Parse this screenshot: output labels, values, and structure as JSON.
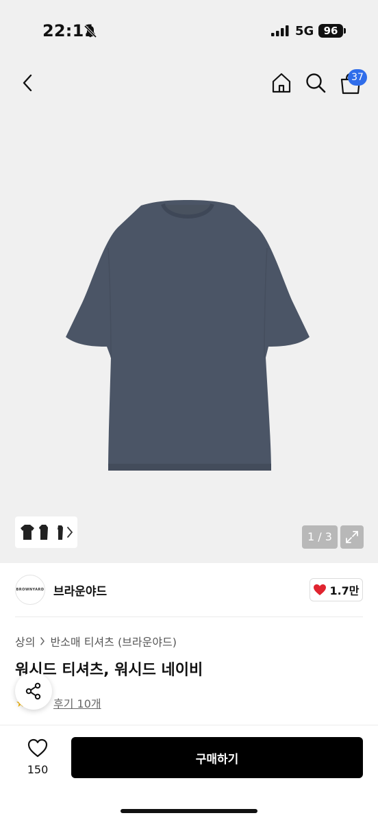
{
  "status_bar": {
    "time": "22:11",
    "network": "5G",
    "battery": "96"
  },
  "nav": {
    "cart_count": "37",
    "icons": [
      "chevron-left-icon",
      "home-icon",
      "search-icon",
      "shopping-bag-icon"
    ]
  },
  "gallery": {
    "pager": "1 / 3"
  },
  "brand": {
    "logo_text": "BROWNYARD",
    "name": "브라운야드",
    "likes": "1.7만",
    "heart_color": "#e0242f"
  },
  "breadcrumb": {
    "category": "상의",
    "subcategory": "반소매 티셔츠 (브라운야드)"
  },
  "product": {
    "title": "워시드 티셔츠, 워시드 네이비",
    "shirt_color": "#4b5566",
    "review_text": "후기 10개"
  },
  "bottom_bar": {
    "wish_count": "150",
    "buy_label": "구매하기"
  }
}
